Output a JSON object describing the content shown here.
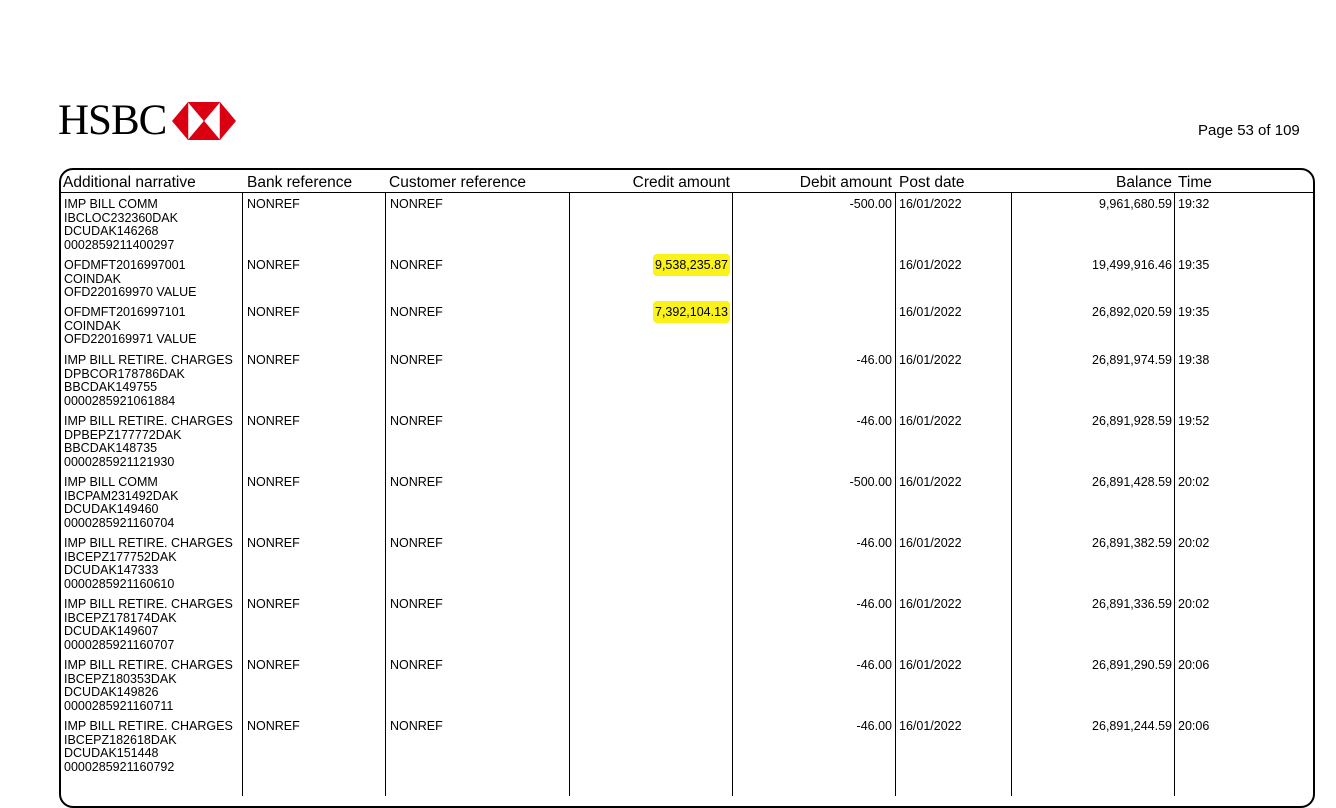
{
  "header": {
    "bank_name": "HSBC",
    "page_label": "Page 53 of 109"
  },
  "colors": {
    "logo_red": "#db0011",
    "highlight": "#fbf21a"
  },
  "table": {
    "columns": [
      "Additional narrative",
      "Bank reference",
      "Customer reference",
      "Credit amount",
      "Debit amount",
      "Post date",
      "Balance",
      "Time"
    ],
    "rows": [
      {
        "narrative": [
          "IMP BILL COMM",
          "IBCLOC232360DAK",
          "DCUDAK146268",
          "0002859211400297"
        ],
        "bank_ref": "NONREF",
        "customer_ref": "NONREF",
        "credit": "",
        "debit": "-500.00",
        "post_date": "16/01/2022",
        "balance": "9,961,680.59",
        "time": "19:32"
      },
      {
        "narrative": [
          "OFDMFT2016997001",
          "COINDAK",
          "OFD220169970  VALUE"
        ],
        "bank_ref": "NONREF",
        "customer_ref": "NONREF",
        "credit": "9,538,235.87",
        "debit": "",
        "post_date": "16/01/2022",
        "balance": "19,499,916.46",
        "time": "19:35"
      },
      {
        "narrative": [
          "OFDMFT2016997101",
          "COINDAK",
          "OFD220169971  VALUE"
        ],
        "bank_ref": "NONREF",
        "customer_ref": "NONREF",
        "credit": "7,392,104.13",
        "debit": "",
        "post_date": "16/01/2022",
        "balance": "26,892,020.59",
        "time": "19:35"
      },
      {
        "narrative": [
          "IMP BILL RETIRE. CHARGES",
          "DPBCOR178786DAK",
          "BBCDAK149755",
          "0000285921061884"
        ],
        "bank_ref": "NONREF",
        "customer_ref": "NONREF",
        "credit": "",
        "debit": "-46.00",
        "post_date": "16/01/2022",
        "balance": "26,891,974.59",
        "time": "19:38"
      },
      {
        "narrative": [
          "IMP BILL RETIRE. CHARGES",
          "DPBEPZ177772DAK",
          "BBCDAK148735",
          "0000285921121930"
        ],
        "bank_ref": "NONREF",
        "customer_ref": "NONREF",
        "credit": "",
        "debit": "-46.00",
        "post_date": "16/01/2022",
        "balance": "26,891,928.59",
        "time": "19:52"
      },
      {
        "narrative": [
          "IMP BILL COMM",
          "IBCPAM231492DAK",
          "DCUDAK149460",
          "0000285921160704"
        ],
        "bank_ref": "NONREF",
        "customer_ref": "NONREF",
        "credit": "",
        "debit": "-500.00",
        "post_date": "16/01/2022",
        "balance": "26,891,428.59",
        "time": "20:02"
      },
      {
        "narrative": [
          "IMP BILL RETIRE. CHARGES",
          "IBCEPZ177752DAK",
          "DCUDAK147333",
          "0000285921160610"
        ],
        "bank_ref": "NONREF",
        "customer_ref": "NONREF",
        "credit": "",
        "debit": "-46.00",
        "post_date": "16/01/2022",
        "balance": "26,891,382.59",
        "time": "20:02"
      },
      {
        "narrative": [
          "IMP BILL RETIRE. CHARGES",
          "IBCEPZ178174DAK",
          "DCUDAK149607",
          "0000285921160707"
        ],
        "bank_ref": "NONREF",
        "customer_ref": "NONREF",
        "credit": "",
        "debit": "-46.00",
        "post_date": "16/01/2022",
        "balance": "26,891,336.59",
        "time": "20:02"
      },
      {
        "narrative": [
          "IMP BILL RETIRE. CHARGES",
          "IBCEPZ180353DAK",
          "DCUDAK149826",
          "0000285921160711"
        ],
        "bank_ref": "NONREF",
        "customer_ref": "NONREF",
        "credit": "",
        "debit": "-46.00",
        "post_date": "16/01/2022",
        "balance": "26,891,290.59",
        "time": "20:06"
      },
      {
        "narrative": [
          "IMP BILL RETIRE. CHARGES",
          "IBCEPZ182618DAK",
          "DCUDAK151448",
          "0000285921160792"
        ],
        "bank_ref": "NONREF",
        "customer_ref": "NONREF",
        "credit": "",
        "debit": "-46.00",
        "post_date": "16/01/2022",
        "balance": "26,891,244.59",
        "time": "20:06"
      }
    ]
  }
}
